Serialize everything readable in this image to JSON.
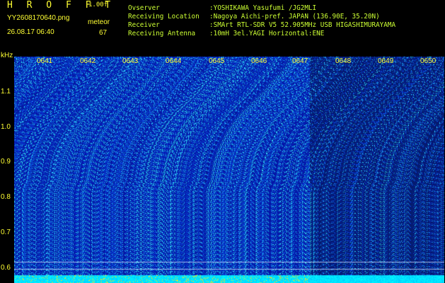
{
  "header": {
    "app_title": "H R O F F T",
    "version": "1.00f",
    "filename": "YY2608170640.png",
    "meteor_label": "meteor",
    "datetime": "26.08.17 06:40",
    "meteor_count": "67"
  },
  "info": [
    {
      "label": "Ovserver",
      "value": ":YOSHIKAWA Yasufumi /JG2MLI"
    },
    {
      "label": "Receiving Location",
      "value": ":Nagoya Aichi-pref. JAPAN (136.90E, 35.20N)"
    },
    {
      "label": "Receiver",
      "value": ":SMArt RTL-SDR V5 52.905MHz USB HIGASHIMURAYAMA"
    },
    {
      "label": "Receiving Antenna",
      "value": ":10mH 3el.YAGI Horizontal:ENE"
    }
  ],
  "axis": {
    "unit": "kHz",
    "y_ticks": [
      "1.1",
      "1.0",
      "0.9",
      "0.8",
      "0.7",
      "0.6"
    ],
    "x_ticks": [
      "0641",
      "0642",
      "0643",
      "0644",
      "0645",
      "0646",
      "0647",
      "0648",
      "0649",
      "0650"
    ]
  },
  "colors": {
    "background": "#000000",
    "text": "#ffff33",
    "waterfall_base": "#0a14a0",
    "noise": "#33ccff"
  }
}
